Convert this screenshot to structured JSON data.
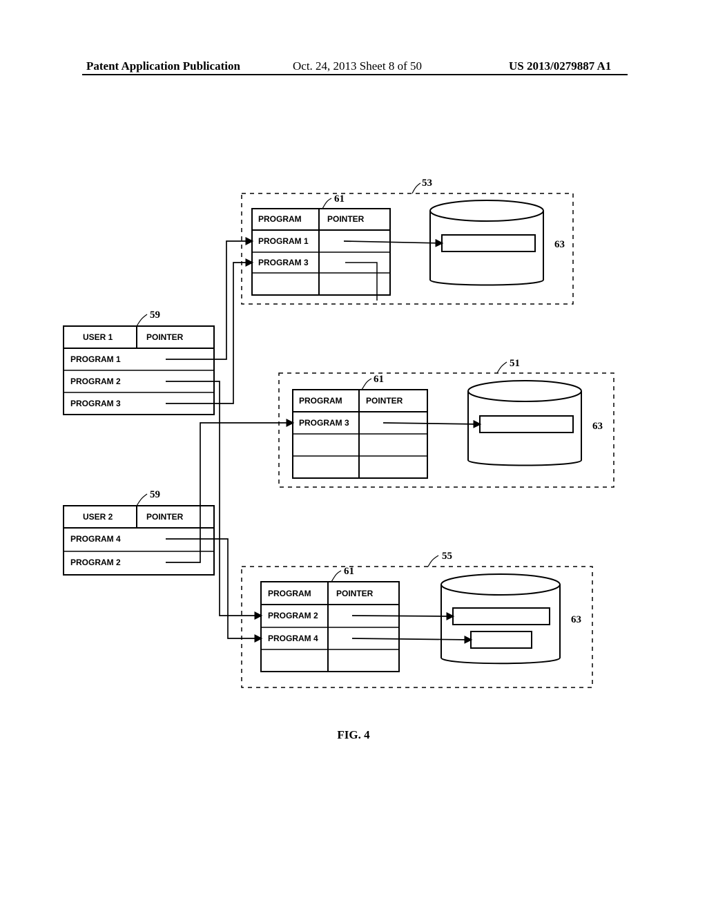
{
  "header": {
    "left": "Patent Application Publication",
    "mid": "Oct. 24, 2013  Sheet 8 of 50",
    "right": "US 2013/0279887 A1"
  },
  "figure": {
    "caption": "FIG. 4",
    "labels": {
      "program": "PROGRAM",
      "pointer": "POINTER",
      "user1": "USER 1",
      "user2": "USER 2",
      "prog1": "PROGRAM 1",
      "prog2": "PROGRAM 2",
      "prog3": "PROGRAM 3",
      "prog4": "PROGRAM 4"
    },
    "refs": {
      "r51": "51",
      "r53": "53",
      "r55": "55",
      "r59a": "59",
      "r59b": "59",
      "r61a": "61",
      "r61b": "61",
      "r61c": "61",
      "r63a": "63",
      "r63b": "63",
      "r63c": "63"
    }
  },
  "chart_data": {
    "type": "diagram",
    "title": "FIG. 4",
    "tables": [
      {
        "id": 59,
        "instance": "user1",
        "headers": [
          "USER 1",
          "POINTER"
        ],
        "rows": [
          {
            "program": "PROGRAM 1",
            "points_to": {
              "server": 53,
              "table": 61,
              "row": "PROGRAM 1"
            }
          },
          {
            "program": "PROGRAM 2",
            "points_to": {
              "server": 55,
              "table": 61,
              "row": "PROGRAM 2"
            }
          },
          {
            "program": "PROGRAM 3",
            "points_to": {
              "server": 53,
              "table": 61,
              "row": "PROGRAM 3"
            }
          }
        ]
      },
      {
        "id": 59,
        "instance": "user2",
        "headers": [
          "USER 2",
          "POINTER"
        ],
        "rows": [
          {
            "program": "PROGRAM 4",
            "points_to": {
              "server": 55,
              "table": 61,
              "row": "PROGRAM 4"
            }
          },
          {
            "program": "PROGRAM 2",
            "points_to": {
              "server": 51,
              "table": 61,
              "row": "PROGRAM 3"
            }
          }
        ]
      }
    ],
    "servers": [
      {
        "id": 53,
        "table": {
          "id": 61,
          "headers": [
            "PROGRAM",
            "POINTER"
          ],
          "rows": [
            {
              "program": "PROGRAM 1",
              "points_to_db_record": 1
            },
            {
              "program": "PROGRAM 3",
              "points_to_db_record": null
            }
          ]
        },
        "database": {
          "id": 63,
          "records": 1
        }
      },
      {
        "id": 51,
        "table": {
          "id": 61,
          "headers": [
            "PROGRAM",
            "POINTER"
          ],
          "rows": [
            {
              "program": "PROGRAM 3",
              "points_to_db_record": 1
            }
          ]
        },
        "database": {
          "id": 63,
          "records": 1
        }
      },
      {
        "id": 55,
        "table": {
          "id": 61,
          "headers": [
            "PROGRAM",
            "POINTER"
          ],
          "rows": [
            {
              "program": "PROGRAM 2",
              "points_to_db_record": 1
            },
            {
              "program": "PROGRAM 4",
              "points_to_db_record": 2
            }
          ]
        },
        "database": {
          "id": 63,
          "records": 2
        }
      }
    ]
  }
}
